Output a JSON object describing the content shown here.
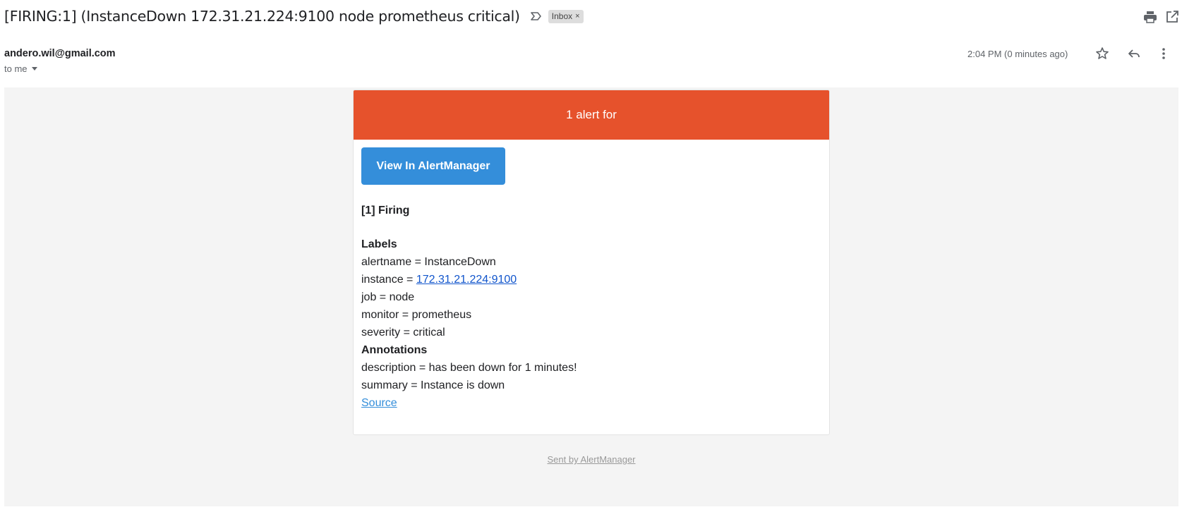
{
  "email": {
    "subject": "[FIRING:1] (InstanceDown 172.31.21.224:9100 node prometheus critical)",
    "label_chip": "Inbox",
    "label_chip_close": "×",
    "sender": "andero.wil@gmail.com",
    "recipient": "to me",
    "timestamp": "2:04 PM (0 minutes ago)"
  },
  "icons": {
    "important": "label-important-icon",
    "print": "print-icon",
    "open_new_window": "open-in-new-icon",
    "star": "star-icon",
    "reply": "reply-icon",
    "more": "more-vert-icon"
  },
  "alert": {
    "header": "1 alert for",
    "button_label": "View In AlertManager",
    "firing_title": "[1] Firing",
    "labels_title": "Labels",
    "labels": [
      {
        "key": "alertname = ",
        "value": "InstanceDown",
        "link": false
      },
      {
        "key": "instance = ",
        "value": "172.31.21.224:9100",
        "link": true
      },
      {
        "key": "job = ",
        "value": "node",
        "link": false
      },
      {
        "key": "monitor = ",
        "value": "prometheus",
        "link": false
      },
      {
        "key": "severity = ",
        "value": "critical",
        "link": false
      }
    ],
    "annotations_title": "Annotations",
    "annotations": [
      {
        "key": "description = ",
        "value": "has been down for 1 minutes!"
      },
      {
        "key": "summary = ",
        "value": "Instance is down"
      }
    ],
    "source_link": "Source",
    "footer": "Sent by AlertManager"
  },
  "colors": {
    "header_bg": "#e6522c",
    "button_bg": "#348eda",
    "link": "#1155cc",
    "body_bg": "#f4f4f4"
  }
}
